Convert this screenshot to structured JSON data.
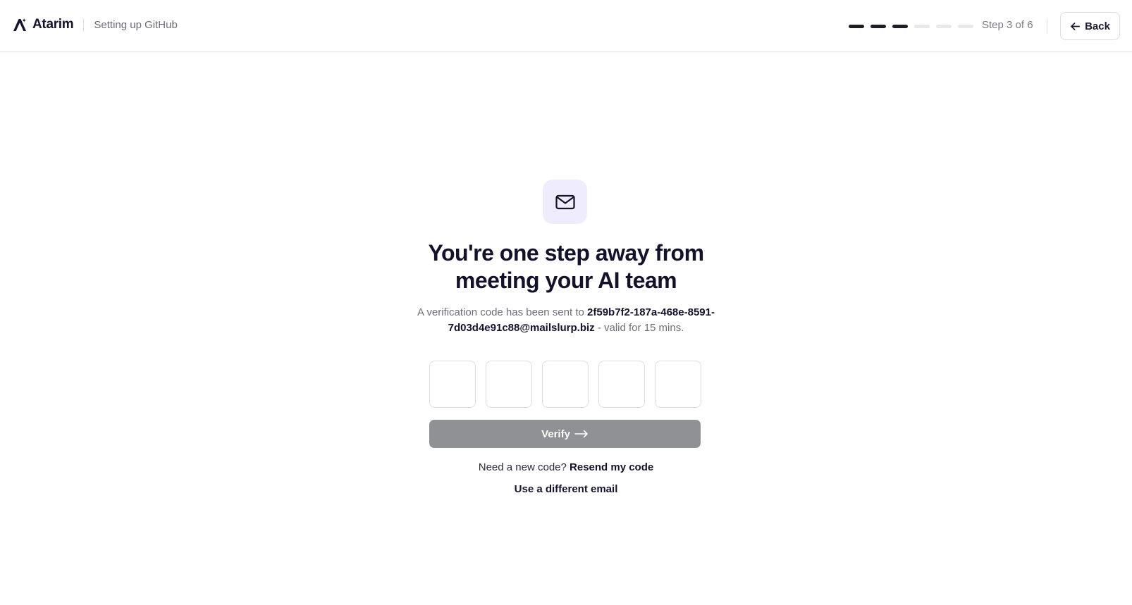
{
  "header": {
    "brand_name": "Atarim",
    "context_label": "Setting up GitHub",
    "progress": {
      "current_step": 3,
      "total_steps": 6
    },
    "step_label": "Step 3 of 6",
    "back_label": "Back"
  },
  "main": {
    "icon": "envelope-icon",
    "headline_line1": "You're one step away from",
    "headline_line2": "meeting your AI team",
    "sub_prefix": "A verification code has been sent to ",
    "email_line1": "2f59b7f2-187a-468e-8591-",
    "email_line2": "7d03d4e91c88@mailslurp.biz",
    "sub_suffix": " - valid for 15 mins.",
    "code_digits": [
      "",
      "",
      "",
      "",
      ""
    ],
    "verify_label": "Verify",
    "resend_prompt": "Need a new code? ",
    "resend_link": "Resend my code",
    "different_email": "Use a different email"
  },
  "colors": {
    "accent_dark": "#14112b",
    "envelope_bg": "#efedfd",
    "verify_disabled_bg": "#8f9194",
    "progress_done": "#1e1d28",
    "progress_pending": "#e8e8ee"
  }
}
